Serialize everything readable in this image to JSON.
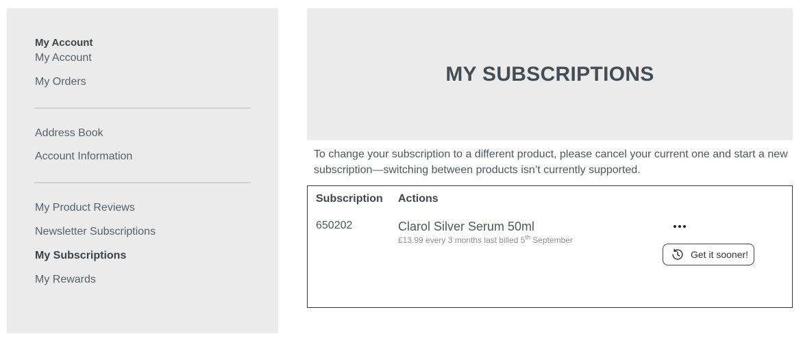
{
  "sidebar": {
    "title": "My Account",
    "group1": [
      "My Account",
      "My Orders"
    ],
    "group2": [
      "Address Book",
      "Account Information"
    ],
    "group3": [
      "My Product Reviews",
      "Newsletter Subscriptions",
      "My Subscriptions",
      "My Rewards"
    ],
    "active_item": "My Subscriptions"
  },
  "header": {
    "title": "MY SUBSCRIPTIONS"
  },
  "notice": {
    "line1": "To change your subscription to a different product, please cancel your current one and start a new",
    "line2": "subscription—switching between products isn’t currently supported."
  },
  "table": {
    "columns": [
      "Subscription",
      "Actions"
    ],
    "rows": [
      {
        "id": "650202",
        "product": "Clarol Silver Serum 50ml",
        "meta_prefix": "£13.99 every 3 months last billed 5",
        "meta_sup": "th",
        "meta_suffix": " September",
        "action_button": "Get it sooner!"
      }
    ]
  },
  "icons": {
    "more": "more-dots-icon",
    "sooner": "clock-history-icon"
  }
}
